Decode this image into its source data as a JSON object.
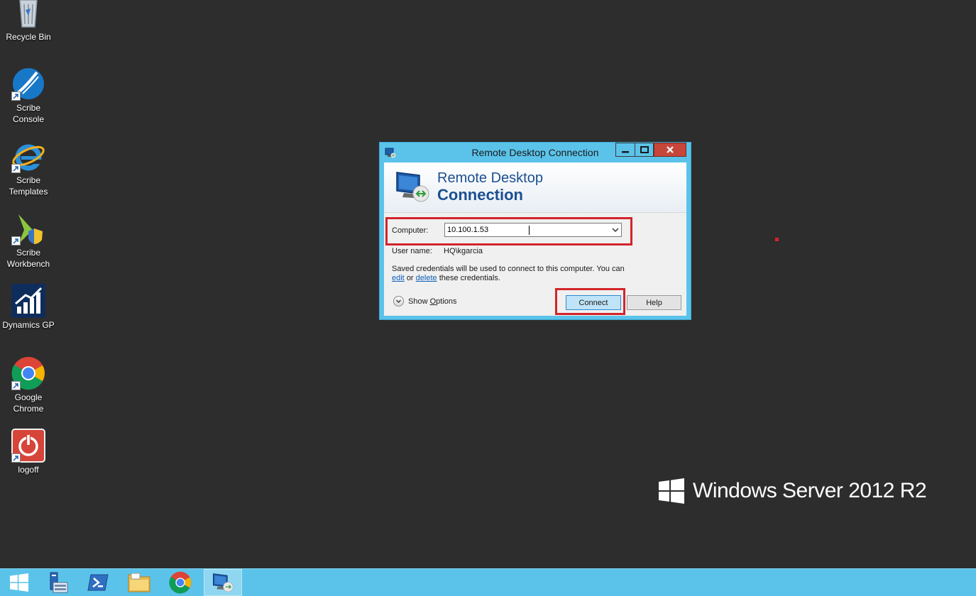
{
  "desktop": {
    "icons": [
      {
        "label": "Recycle Bin",
        "icon": "recycle-bin-icon"
      },
      {
        "label_line1": "Scribe",
        "label_line2": "Console",
        "icon": "scribe-console-icon"
      },
      {
        "label_line1": "Scribe",
        "label_line2": "Templates",
        "icon": "internet-explorer-icon"
      },
      {
        "label_line1": "Scribe",
        "label_line2": "Workbench",
        "icon": "scribe-workbench-icon"
      },
      {
        "label": "Dynamics GP",
        "icon": "dynamics-gp-icon"
      },
      {
        "label_line1": "Google",
        "label_line2": "Chrome",
        "icon": "chrome-icon"
      },
      {
        "label": "logoff",
        "icon": "logoff-icon"
      }
    ],
    "branding": "Windows Server 2012 R2"
  },
  "dialog": {
    "title": "Remote Desktop Connection",
    "banner_line1": "Remote Desktop",
    "banner_line2": "Connection",
    "computer_label": "Computer:",
    "computer_value": "10.100.1.53",
    "user_label": "User name:",
    "user_value": "HQ\\kgarcia",
    "note_part1": "Saved credentials will be used to connect to this computer.  You can",
    "note_edit": "edit",
    "note_or": "or",
    "note_delete": "delete",
    "note_part2": "these credentials.",
    "show_options_prefix": "Show ",
    "show_options_underlined": "O",
    "show_options_suffix": "ptions",
    "connect_label": "Connect",
    "help_label": "Help"
  },
  "taskbar": {
    "items": [
      "start-icon",
      "server-manager-icon",
      "powershell-icon",
      "file-explorer-icon",
      "chrome-icon",
      "remote-desktop-icon"
    ],
    "active": "remote-desktop-icon"
  },
  "colors": {
    "desktop": "#2d2d2d",
    "taskbar": "#5bc3ea",
    "highlight": "#d2252a",
    "close_button": "#c7463a"
  }
}
